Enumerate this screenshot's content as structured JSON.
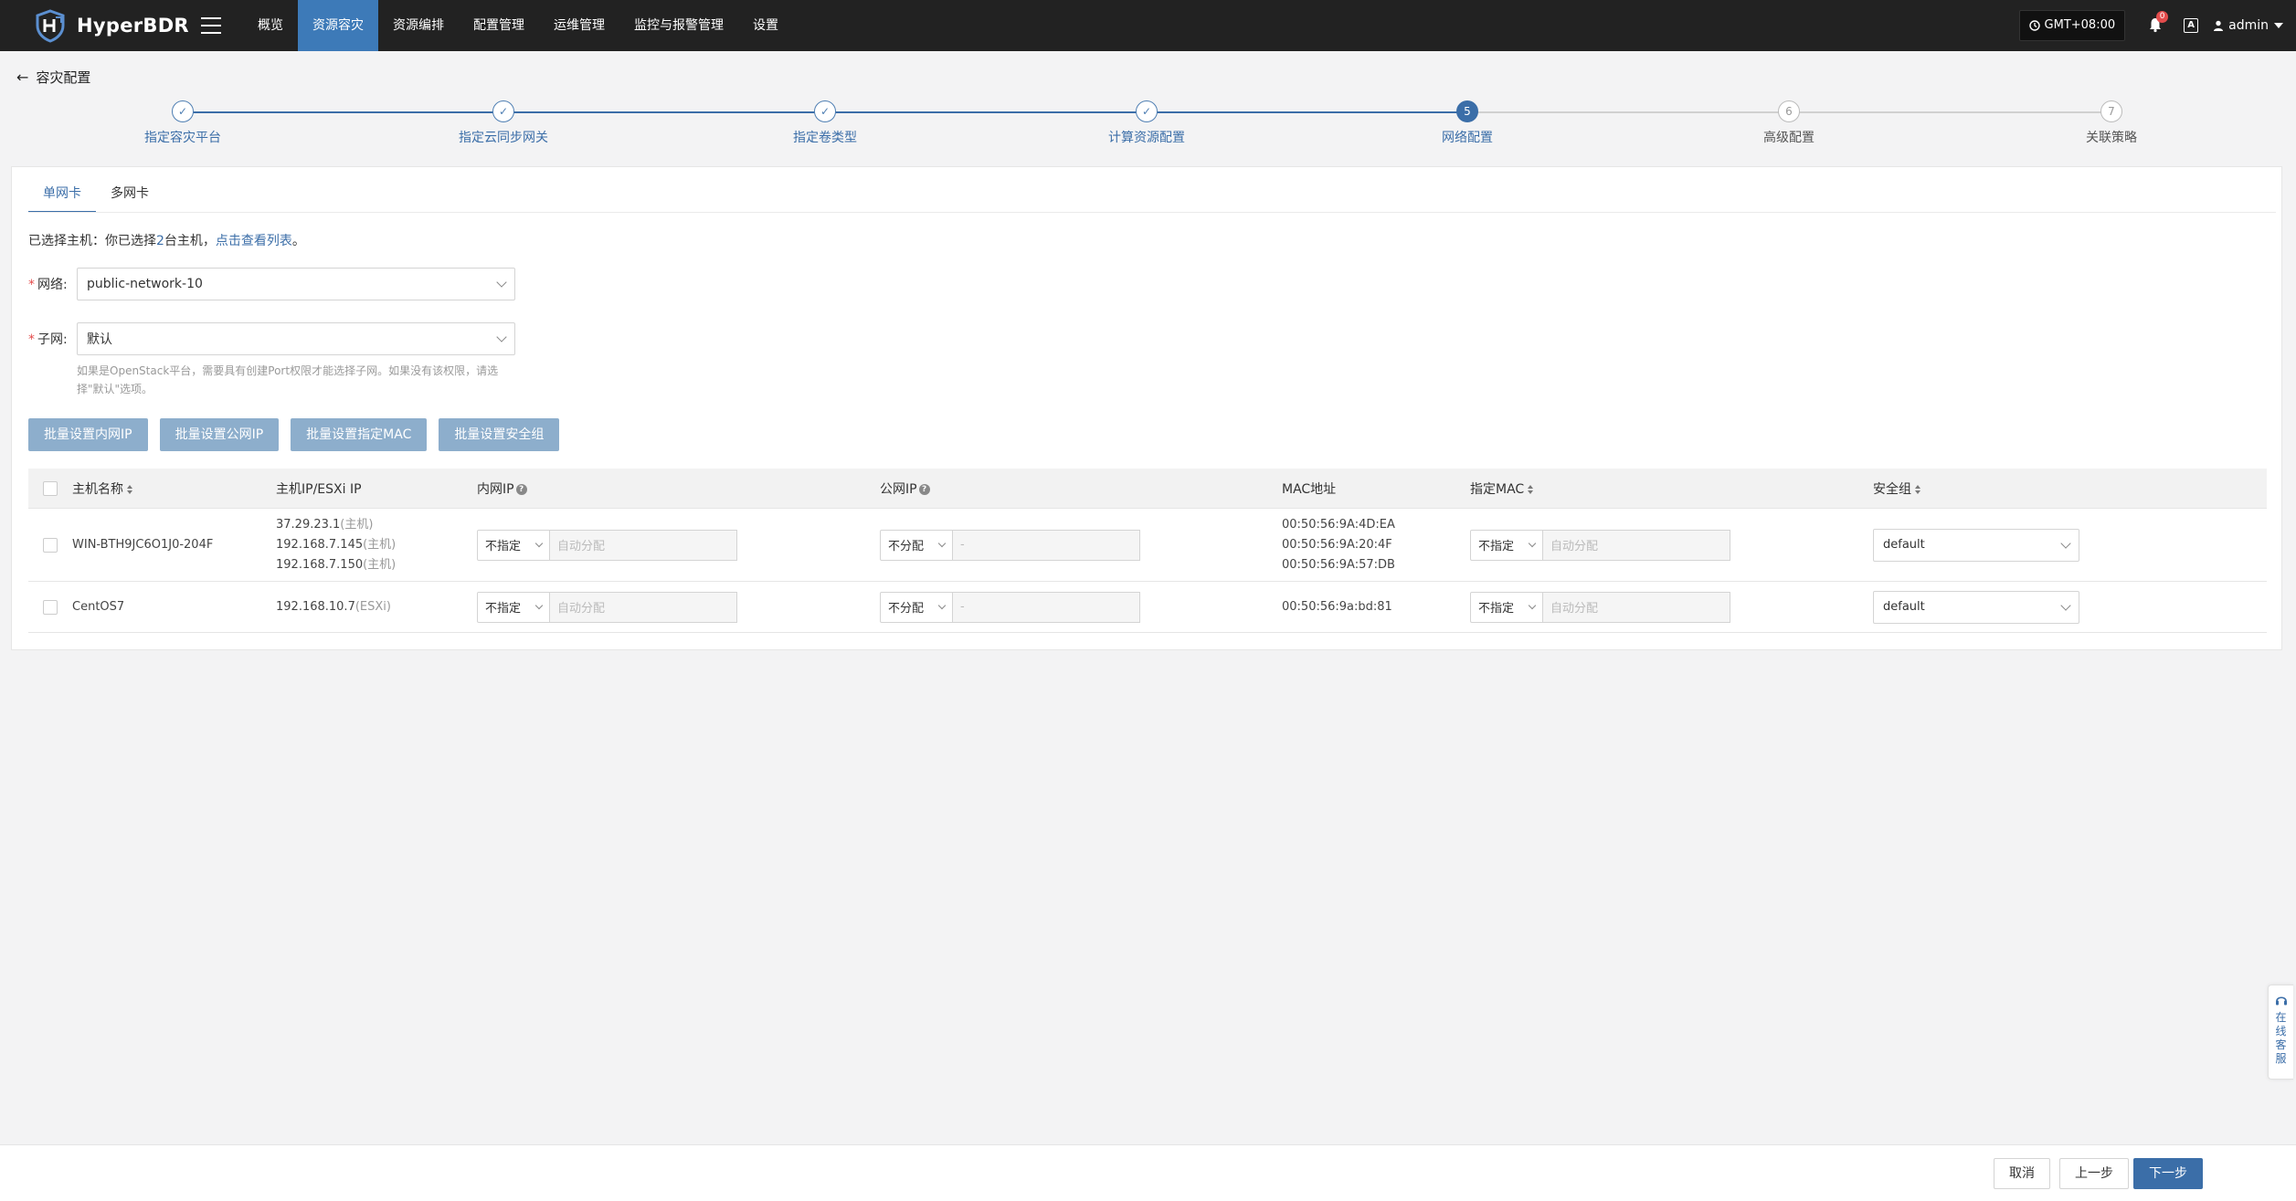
{
  "app": {
    "name": "HyperBDR"
  },
  "nav": {
    "items": [
      {
        "label": "概览",
        "active": false
      },
      {
        "label": "资源容灾",
        "active": true
      },
      {
        "label": "资源编排",
        "active": false
      },
      {
        "label": "配置管理",
        "active": false
      },
      {
        "label": "运维管理",
        "active": false
      },
      {
        "label": "监控与报警管理",
        "active": false
      },
      {
        "label": "设置",
        "active": false
      }
    ]
  },
  "header": {
    "timezone": "GMT+08:00",
    "notifications": "0",
    "translate_label": "A",
    "user": "admin"
  },
  "page": {
    "back_title": "容灾配置"
  },
  "steps": [
    {
      "label": "指定容灾平台",
      "state": "done"
    },
    {
      "label": "指定云同步网关",
      "state": "done"
    },
    {
      "label": "指定卷类型",
      "state": "done"
    },
    {
      "label": "计算资源配置",
      "state": "done"
    },
    {
      "label": "网络配置",
      "state": "current",
      "num": "5"
    },
    {
      "label": "高级配置",
      "state": "todo",
      "num": "6"
    },
    {
      "label": "关联策略",
      "state": "todo",
      "num": "7"
    }
  ],
  "tabs": {
    "single": "单网卡",
    "multi": "多网卡"
  },
  "selected": {
    "prefix": "已选择主机：你已选择",
    "count": "2",
    "suffix": "台主机，",
    "link": "点击查看列表",
    "end": "。"
  },
  "form": {
    "network_label": "网络:",
    "network_value": "public-network-10",
    "subnet_label": "子网:",
    "subnet_value": "默认",
    "hint": "如果是OpenStack平台，需要具有创建Port权限才能选择子网。如果没有该权限，请选择\"默认\"选项。"
  },
  "batch": {
    "internal_ip": "批量设置内网IP",
    "public_ip": "批量设置公网IP",
    "mac": "批量设置指定MAC",
    "security_group": "批量设置安全组"
  },
  "table": {
    "headers": {
      "host_name": "主机名称",
      "host_ip": "主机IP/ESXi IP",
      "internal_ip": "内网IP",
      "public_ip": "公网IP",
      "mac": "MAC地址",
      "assigned_mac": "指定MAC",
      "security_group": "安全组"
    },
    "rows": [
      {
        "name": "WIN-BTH9JC6O1J0-204F",
        "ips": [
          {
            "ip": "37.29.23.1",
            "tag": "(主机)"
          },
          {
            "ip": "192.168.7.145",
            "tag": "(主机)"
          },
          {
            "ip": "192.168.7.150",
            "tag": "(主机)"
          }
        ],
        "internal_mode": "不指定",
        "internal_placeholder": "自动分配",
        "public_mode": "不分配",
        "public_placeholder": "-",
        "macs": [
          "00:50:56:9A:4D:EA",
          "00:50:56:9A:20:4F",
          "00:50:56:9A:57:DB"
        ],
        "assigned_mode": "不指定",
        "assigned_placeholder": "自动分配",
        "security_group": "default"
      },
      {
        "name": "CentOS7",
        "ips": [
          {
            "ip": "192.168.10.7",
            "tag": "(ESXi)"
          }
        ],
        "internal_mode": "不指定",
        "internal_placeholder": "自动分配",
        "public_mode": "不分配",
        "public_placeholder": "-",
        "macs": [
          "00:50:56:9a:bd:81"
        ],
        "assigned_mode": "不指定",
        "assigned_placeholder": "自动分配",
        "security_group": "default"
      }
    ]
  },
  "float": {
    "service": [
      "在",
      "线",
      "客",
      "服"
    ]
  },
  "footer": {
    "cancel": "取消",
    "prev": "上一步",
    "next": "下一步"
  }
}
